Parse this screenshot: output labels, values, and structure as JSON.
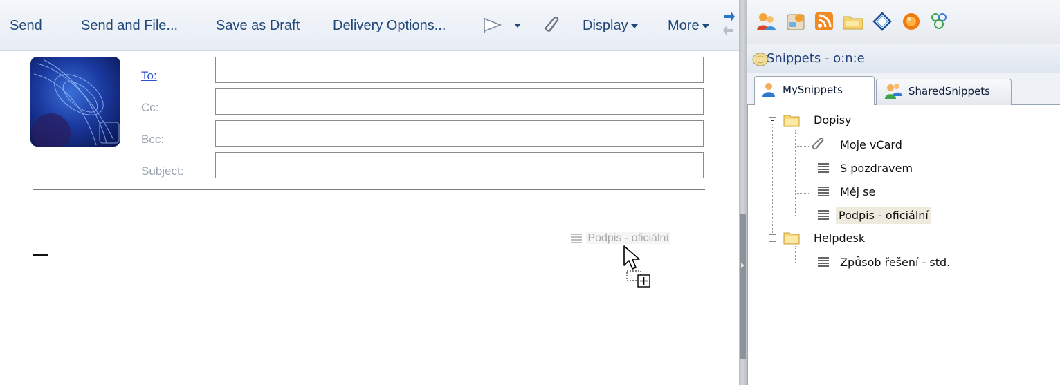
{
  "toolbar": {
    "send": "Send",
    "send_and_file": "Send and File...",
    "save_as_draft": "Save as Draft",
    "delivery_options": "Delivery Options...",
    "display": "Display",
    "more": "More"
  },
  "header_fields": {
    "to_label": "To:",
    "cc_label": "Cc:",
    "bcc_label": "Bcc:",
    "subject_label": "Subject:",
    "to_value": "",
    "cc_value": "",
    "bcc_value": "",
    "subject_value": ""
  },
  "drag": {
    "label": "Podpis - oficiální"
  },
  "sidebar": {
    "title": "Snippets - o:n:e",
    "tabs": [
      {
        "label": "MySnippets",
        "active": true
      },
      {
        "label": "SharedSnippets",
        "active": false
      }
    ],
    "tree": {
      "folders": [
        {
          "name": "Dopisy",
          "items": [
            {
              "label": "Moje vCard",
              "icon": "paperclip-icon"
            },
            {
              "label": "S pozdravem",
              "icon": "text-lines-icon"
            },
            {
              "label": "Měj se",
              "icon": "text-lines-icon"
            },
            {
              "label": "Podpis - oficiální",
              "icon": "text-lines-icon",
              "selected": true
            }
          ]
        },
        {
          "name": "Helpdesk",
          "items": [
            {
              "label": "Způsob řešení - std.",
              "icon": "text-lines-icon"
            }
          ]
        }
      ]
    }
  },
  "colors": {
    "toolbar_text": "#22487a",
    "link_blue": "#2b4fd0",
    "label_gray": "#9aa4b2",
    "selected_bg": "#eeeade"
  }
}
